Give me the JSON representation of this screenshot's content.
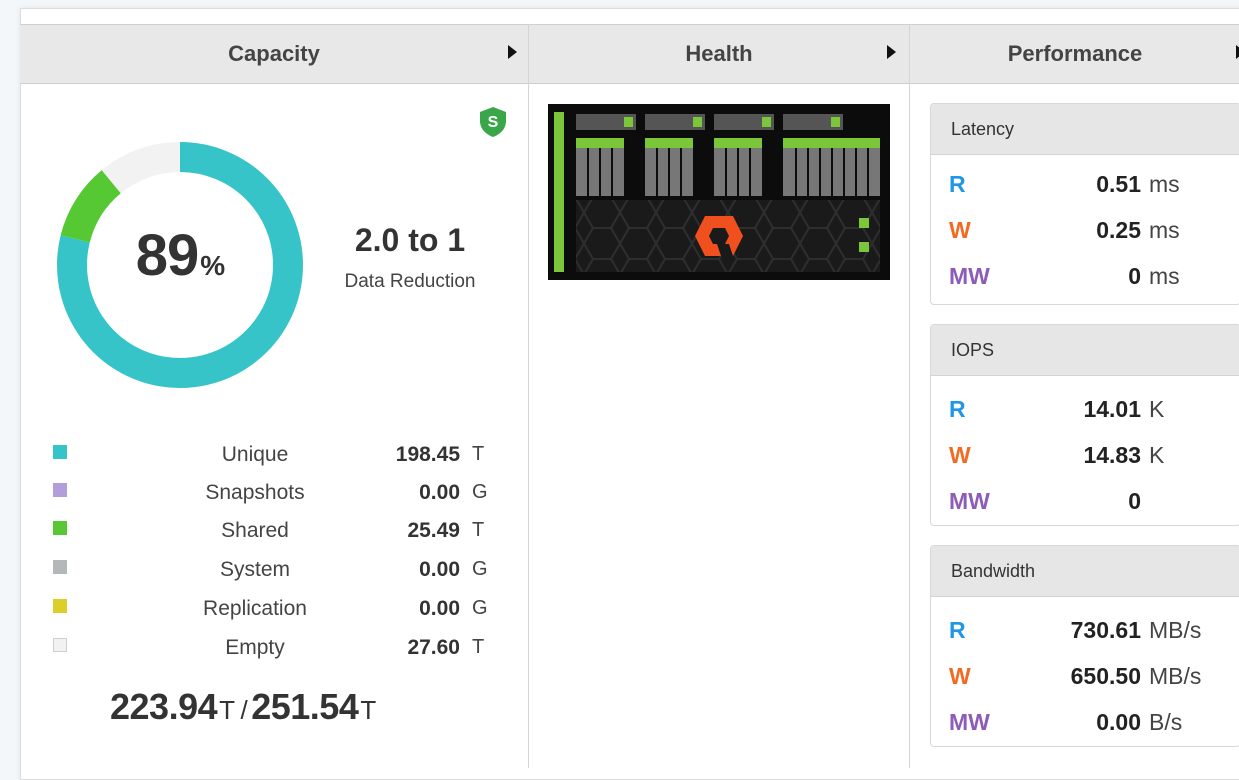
{
  "tabs": [
    {
      "label": "Capacity"
    },
    {
      "label": "Health"
    },
    {
      "label": "Performance"
    }
  ],
  "capacity": {
    "shield_letter": "S",
    "percent": "89",
    "percent_unit": "%",
    "reduction_value": "2.0 to 1",
    "reduction_label": "Data Reduction",
    "donut_segments": [
      {
        "name": "Unique",
        "fraction": 0.7889,
        "color": "#36c4c8"
      },
      {
        "name": "Shared",
        "fraction": 0.1013,
        "color": "#55c834"
      },
      {
        "name": "Empty",
        "fraction": 0.1098,
        "color": "#f2f2f2"
      }
    ],
    "legend": [
      {
        "name": "Unique",
        "value": "198.45",
        "unit": "T",
        "color": "#36c4c8"
      },
      {
        "name": "Snapshots",
        "value": "0.00",
        "unit": "G",
        "color": "#b39ddb"
      },
      {
        "name": "Shared",
        "value": "25.49",
        "unit": "T",
        "color": "#55c834"
      },
      {
        "name": "System",
        "value": "0.00",
        "unit": "G",
        "color": "#b5b8b8"
      },
      {
        "name": "Replication",
        "value": "0.00",
        "unit": "G",
        "color": "#dccf2a"
      },
      {
        "name": "Empty",
        "value": "27.60",
        "unit": "T",
        "color": "#f2f2f2"
      }
    ],
    "used": "223.94",
    "used_unit": "T",
    "separator": "/",
    "total": "251.54",
    "total_unit": "T"
  },
  "performance": {
    "latency": {
      "title": "Latency",
      "rows": [
        {
          "key": "R",
          "value": "0.51",
          "unit": "ms",
          "color": "#2196e8"
        },
        {
          "key": "W",
          "value": "0.25",
          "unit": "ms",
          "color": "#f26b22"
        },
        {
          "key": "MW",
          "value": "0",
          "unit": "ms",
          "color": "#8e5bb5"
        }
      ]
    },
    "iops": {
      "title": "IOPS",
      "rows": [
        {
          "key": "R",
          "value": "14.01",
          "unit": "K",
          "color": "#2196e8"
        },
        {
          "key": "W",
          "value": "14.83",
          "unit": "K",
          "color": "#f26b22"
        },
        {
          "key": "MW",
          "value": "0",
          "unit": "",
          "color": "#8e5bb5"
        }
      ]
    },
    "bandwidth": {
      "title": "Bandwidth",
      "rows": [
        {
          "key": "R",
          "value": "730.61",
          "unit": "MB/s",
          "color": "#2196e8"
        },
        {
          "key": "W",
          "value": "650.50",
          "unit": "MB/s",
          "color": "#f26b22"
        },
        {
          "key": "MW",
          "value": "0.00",
          "unit": "B/s",
          "color": "#8e5bb5"
        }
      ]
    }
  }
}
